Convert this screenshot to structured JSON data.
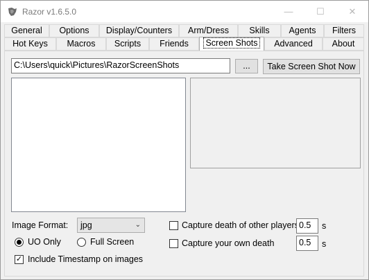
{
  "window": {
    "title": "Razor v1.6.5.0",
    "icon": "razor-app-icon",
    "controls": {
      "minimize": "—",
      "maximize": "☐",
      "close": "✕"
    }
  },
  "tabs": {
    "row1": [
      "General",
      "Options",
      "Display/Counters",
      "Arm/Dress",
      "Skills",
      "Agents",
      "Filters"
    ],
    "row2": [
      "Hot Keys",
      "Macros",
      "Scripts",
      "Friends",
      "Screen Shots",
      "Advanced",
      "About"
    ],
    "active": "Screen Shots"
  },
  "screenshots": {
    "path_value": "C:\\Users\\quick\\Pictures\\RazorScreenShots",
    "browse_label": "...",
    "take_label": "Take Screen Shot Now",
    "image_format_label": "Image Format:",
    "image_format_value": "jpg",
    "uo_only_label": "UO Only",
    "full_screen_label": "Full Screen",
    "uo_only_selected": true,
    "timestamp_label": "Include Timestamp on images",
    "timestamp_checked": true,
    "capture_others_label": "Capture death of other players",
    "capture_others_value": "0.5",
    "capture_own_label": "Capture your own death",
    "capture_own_value": "0.5",
    "seconds_unit": "s"
  }
}
